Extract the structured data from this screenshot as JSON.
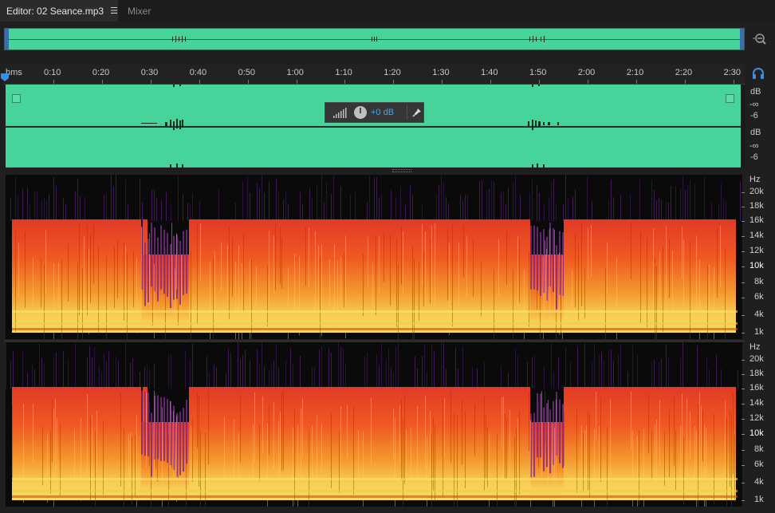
{
  "tabs": {
    "editor_label": "Editor: 02 Seance.mp3",
    "menu_glyph": "☰",
    "mixer_label": "Mixer"
  },
  "ruler": {
    "unit": "hms",
    "labels": [
      "0:10",
      "0:20",
      "0:30",
      "0:40",
      "0:50",
      "1:00",
      "1:10",
      "1:20",
      "1:30",
      "1:40",
      "1:50",
      "2:00",
      "2:10",
      "2:20",
      "2:30"
    ]
  },
  "hud": {
    "volume": "+0 dB"
  },
  "amplitude_scale": {
    "ch1": [
      "dB",
      "-∞",
      "-6"
    ],
    "ch2": [
      "dB",
      "-∞",
      "-6"
    ]
  },
  "spectral_scale": {
    "unit": "Hz",
    "labels": [
      "20k",
      "18k",
      "16k",
      "14k",
      "12k",
      "10k",
      "8k",
      "6k",
      "4k",
      "1k"
    ]
  },
  "colors": {
    "waveform_bg": "#47d49a",
    "waveform_fg": "#0e2a1c",
    "accent": "#3a8ee0",
    "spectrum_hot": "#f7d050",
    "spectrum_mid": "#e0302a",
    "spectrum_cool": "#6a2a8a"
  },
  "icons": {
    "zoom": "zoom-out-icon",
    "monitor": "headphones-icon",
    "pin": "pin-icon",
    "knob": "volume-knob-icon"
  }
}
